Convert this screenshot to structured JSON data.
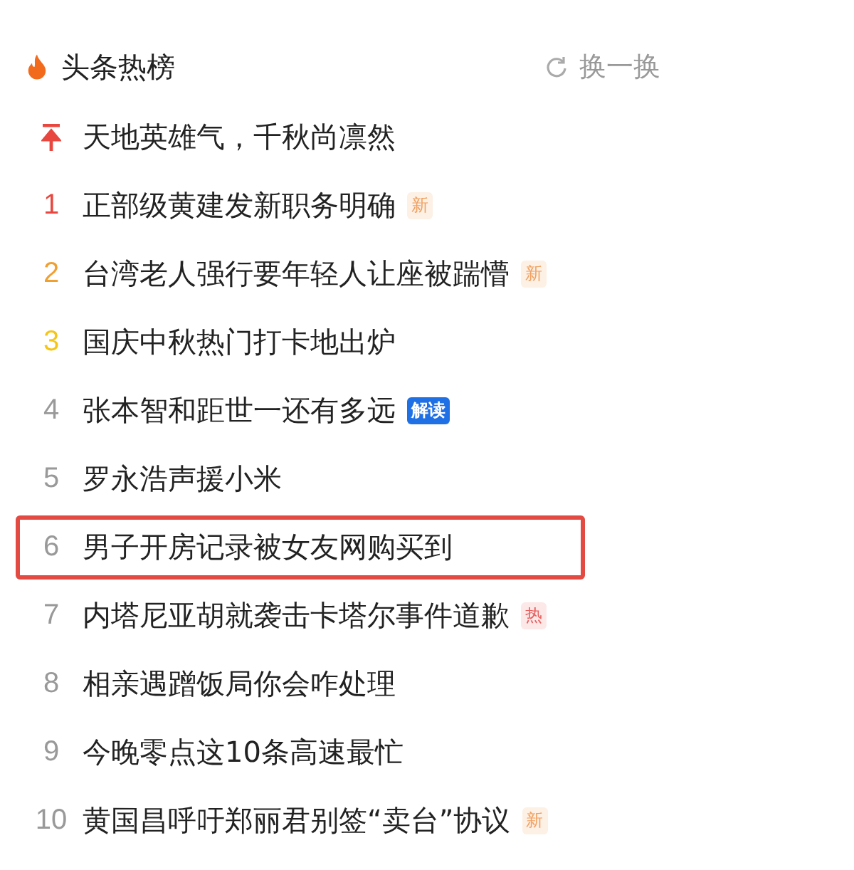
{
  "header": {
    "title": "头条热榜",
    "refresh": "换一换"
  },
  "items": [
    {
      "kind": "pinned",
      "title": "天地英雄气，千秋尚凛然",
      "highlighted": false
    },
    {
      "kind": "ranked",
      "rank": "1",
      "color": "#e8473f",
      "title": "正部级黄建发新职务明确",
      "tag": {
        "kind": "new",
        "text": "新"
      },
      "highlighted": false
    },
    {
      "kind": "ranked",
      "rank": "2",
      "color": "#f0a030",
      "title": "台湾老人强行要年轻人让座被踹懵",
      "tag": {
        "kind": "new",
        "text": "新"
      },
      "highlighted": false
    },
    {
      "kind": "ranked",
      "rank": "3",
      "color": "#f5c518",
      "title": "国庆中秋热门打卡地出炉",
      "highlighted": false
    },
    {
      "kind": "ranked",
      "rank": "4",
      "color": "#999999",
      "title": "张本智和距世一还有多远",
      "tag": {
        "kind": "explain",
        "text": "解读"
      },
      "highlighted": false
    },
    {
      "kind": "ranked",
      "rank": "5",
      "color": "#999999",
      "title": "罗永浩声援小米",
      "highlighted": false
    },
    {
      "kind": "ranked",
      "rank": "6",
      "color": "#999999",
      "title": "男子开房记录被女友网购买到",
      "highlighted": true
    },
    {
      "kind": "ranked",
      "rank": "7",
      "color": "#999999",
      "title": "内塔尼亚胡就袭击卡塔尔事件道歉",
      "tag": {
        "kind": "hot",
        "text": "热"
      },
      "highlighted": false
    },
    {
      "kind": "ranked",
      "rank": "8",
      "color": "#999999",
      "title": "相亲遇蹭饭局你会咋处理",
      "highlighted": false
    },
    {
      "kind": "ranked",
      "rank": "9",
      "color": "#999999",
      "title": "今晚零点这10条高速最忙",
      "highlighted": false
    },
    {
      "kind": "ranked",
      "rank": "10",
      "color": "#999999",
      "title": "黄国昌呼吁郑丽君别签“卖台”协议",
      "tag": {
        "kind": "new",
        "text": "新"
      },
      "highlighted": false
    }
  ]
}
